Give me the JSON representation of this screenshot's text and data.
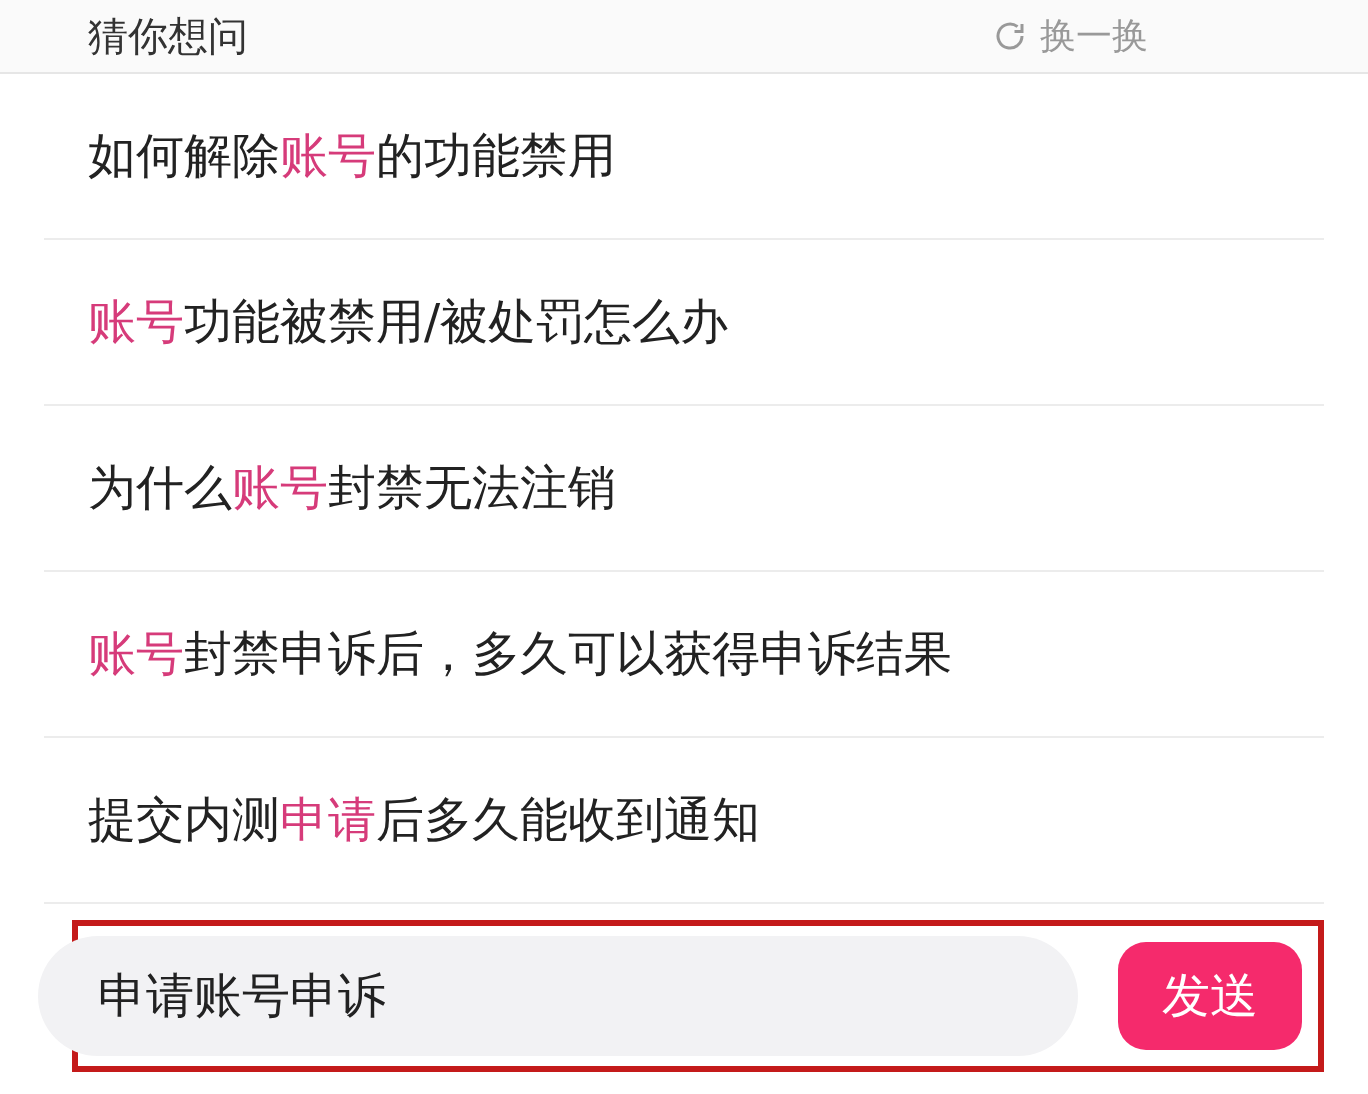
{
  "header": {
    "title": "猜你想问",
    "refresh": "换一换"
  },
  "questions": [
    {
      "parts": [
        {
          "text": "如何解除",
          "highlight": false
        },
        {
          "text": "账号",
          "highlight": true
        },
        {
          "text": "的功能禁用",
          "highlight": false
        }
      ]
    },
    {
      "parts": [
        {
          "text": "账号",
          "highlight": true
        },
        {
          "text": "功能被禁用/被处罚怎么办",
          "highlight": false
        }
      ]
    },
    {
      "parts": [
        {
          "text": "为什么",
          "highlight": false
        },
        {
          "text": "账号",
          "highlight": true
        },
        {
          "text": "封禁无法注销",
          "highlight": false
        }
      ]
    },
    {
      "parts": [
        {
          "text": "账号",
          "highlight": true
        },
        {
          "text": "封禁申诉后，多久可以获得申诉结果",
          "highlight": false
        }
      ]
    },
    {
      "parts": [
        {
          "text": "提交内测",
          "highlight": false
        },
        {
          "text": "申请",
          "highlight": true
        },
        {
          "text": "后多久能收到通知",
          "highlight": false
        }
      ]
    }
  ],
  "composer": {
    "value": "申请账号申诉",
    "send": "发送",
    "highlighted": true
  }
}
